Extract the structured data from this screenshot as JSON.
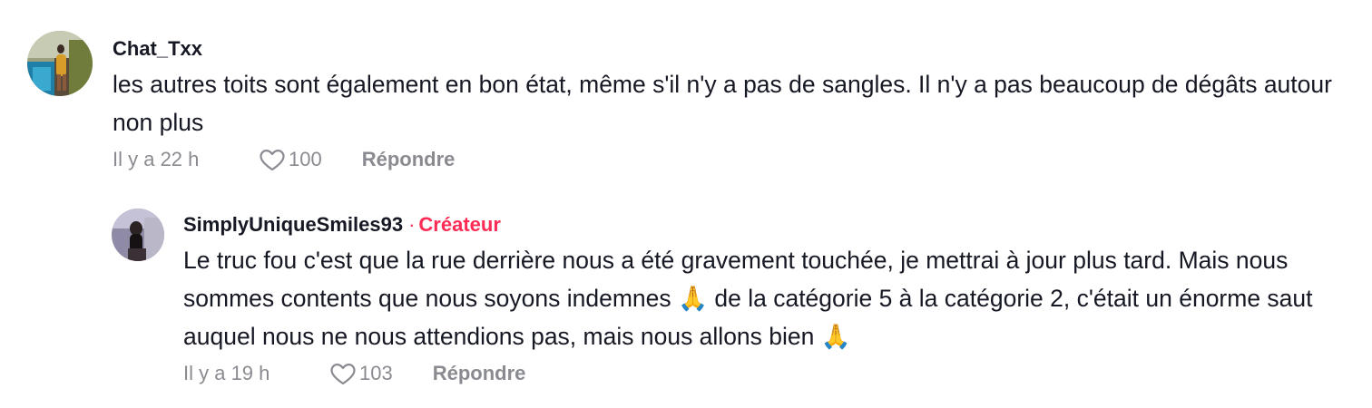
{
  "comments": [
    {
      "username": "Chat_Txx",
      "text": "les autres toits sont également en bon état, même s'il n'y a pas de sangles. Il n'y a pas beaucoup de dégâts autour non plus",
      "time": "Il y a 22 h",
      "likes": "100",
      "reply_label": "Répondre"
    }
  ],
  "reply": {
    "username": "SimplyUniqueSmiles93",
    "badge_separator": "·",
    "badge": "Créateur",
    "text": "Le truc fou c'est que la rue derrière nous a été gravement touchée, je mettrai à jour plus tard. Mais nous sommes contents que nous soyons indemnes 🙏 de la catégorie 5 à la catégorie 2, c'était un énorme saut auquel nous ne nous attendions pas, mais nous allons bien 🙏",
    "time": "Il y a 19 h",
    "likes": "103",
    "reply_label": "Répondre"
  },
  "colors": {
    "text": "#161823",
    "meta": "#8a8b91",
    "creator_badge": "#fe2c55"
  },
  "icons": {
    "like": "heart-outline-icon"
  }
}
